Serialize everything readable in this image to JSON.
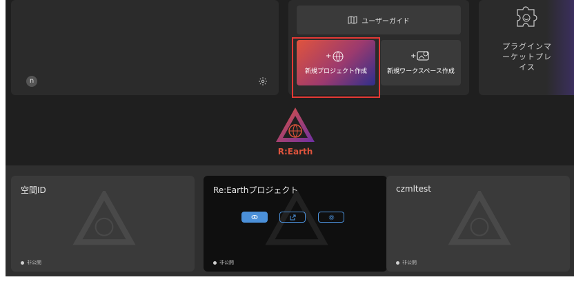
{
  "user_card": {
    "avatar_initial": "n"
  },
  "actions": {
    "user_guide_label": "ユーザーガイド",
    "new_project_label": "新規プロジェクト作成",
    "new_workspace_label": "新規ワークスペース作成"
  },
  "plugin_marketplace": {
    "line1": "プラグインマ",
    "line2": "ーケットプレ",
    "line3": "イス"
  },
  "logo": {
    "text": "R:Earth"
  },
  "projects": [
    {
      "name": "空間ID",
      "status": "非公開"
    },
    {
      "name": "Re:Earthプロジェクト",
      "status": "非公開"
    },
    {
      "name": "czmltest",
      "status": "非公開"
    }
  ],
  "colors": {
    "accent_red": "#e53935",
    "primary_blue": "#4b90d9",
    "brand_orange": "#e0543d"
  }
}
